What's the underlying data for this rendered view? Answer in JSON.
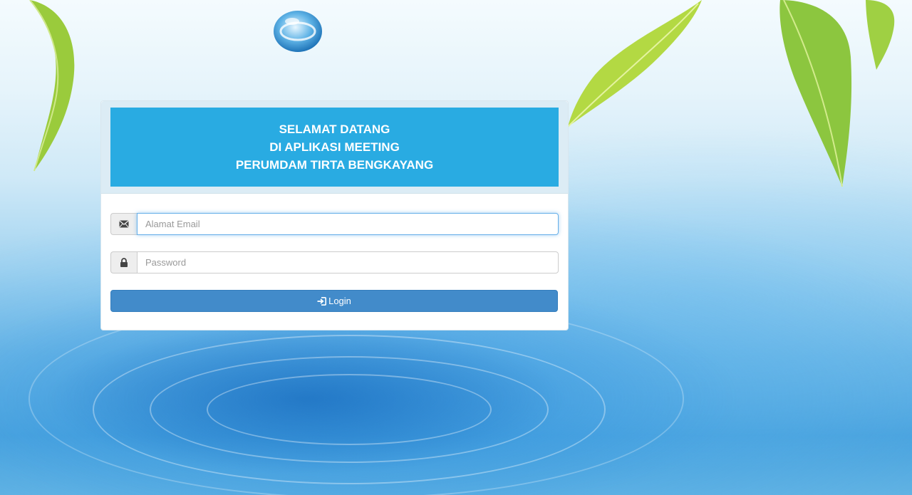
{
  "banner": {
    "line1": "SELAMAT DATANG",
    "line2": "DI APLIKASI MEETING",
    "line3": "PERUMDAM TIRTA BENGKAYANG"
  },
  "form": {
    "email_placeholder": "Alamat Email",
    "email_value": "",
    "email_icon": "envelope-icon",
    "password_placeholder": "Password",
    "password_value": "",
    "password_icon": "lock-icon",
    "login_label": "Login",
    "login_icon": "log-in-icon"
  },
  "colors": {
    "banner": "#29abe2",
    "button": "#428bca",
    "focus": "#66afe9"
  }
}
